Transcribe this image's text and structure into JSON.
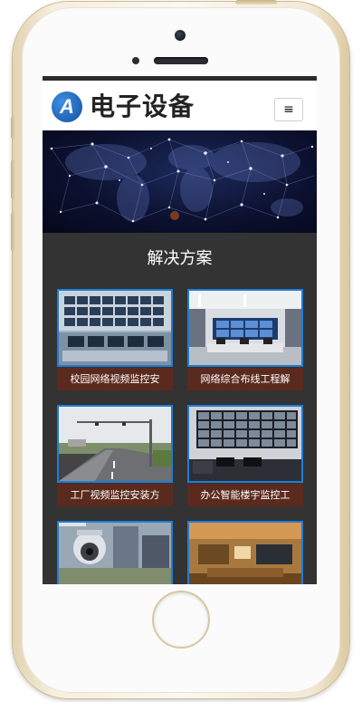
{
  "header": {
    "logo_letter": "A",
    "site_title": "电子设备",
    "menu_icon": "≡"
  },
  "section": {
    "title": "解决方案"
  },
  "cards": [
    {
      "label": "校园网络视频监控安"
    },
    {
      "label": "网络综合布线工程解"
    },
    {
      "label": "工厂视频监控安装方"
    },
    {
      "label": "办公智能楼宇监控工"
    },
    {
      "label": ""
    },
    {
      "label": ""
    }
  ],
  "colors": {
    "accent_border": "#1f7dd6",
    "label_background": "#5b2a1e",
    "section_background": "#333333",
    "logo_blue": "#1550a6"
  }
}
